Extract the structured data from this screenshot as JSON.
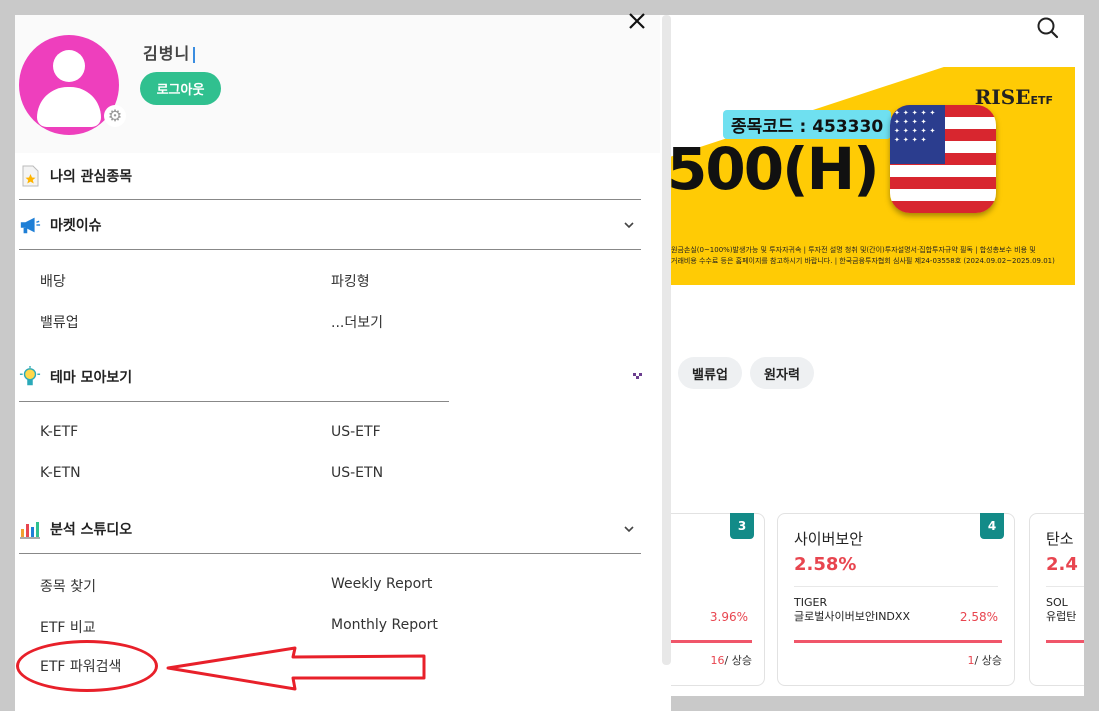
{
  "page": {
    "banner": {
      "logo": "RISE",
      "logo_suffix": "ETF",
      "code_label": "종목코드 : 453330",
      "big_text": "500(H)",
      "fine_print_1": "원금손실(0~100%)발생가능 및 투자자귀속 | 투자전 설명 청취 및(간이)투자설명서·집합투자규약 필독 | 합성총보수 비용 및",
      "fine_print_2": "거래비용 수수료 등은 홈페이지를 참고하시기 바랍니다. | 한국금융투자협회 심사필 제24-03558호 (2024.09.02~2025.09.01)"
    },
    "chips": [
      "밸류업",
      "원자력"
    ],
    "cards": [
      {
        "rank": "3",
        "name": "",
        "pct": "",
        "fund": "",
        "fund_pct": "3.96%",
        "count": "16",
        "count_suffix": "/ 상승"
      },
      {
        "rank": "4",
        "name": "사이버보안",
        "pct": "2.58%",
        "fund": "TIGER\n글로벌사이버보안INDXX",
        "fund_pct": "2.58%",
        "count": "1",
        "count_suffix": "/ 상승"
      },
      {
        "rank": "",
        "name": "탄소",
        "pct": "2.4",
        "fund": "SOL\n유럽탄",
        "fund_pct": "",
        "count": "",
        "count_suffix": ""
      }
    ]
  },
  "menu": {
    "profile": {
      "username": "김병니",
      "logout_label": "로그아웃"
    },
    "sections": {
      "watchlist": {
        "label": "나의 관심종목"
      },
      "market_issue": {
        "label": "마켓이슈",
        "items": [
          "배당",
          "파킹형",
          "밸류업",
          "...더보기"
        ]
      },
      "theme": {
        "label": "테마 모아보기",
        "items": [
          "K-ETF",
          "US-ETF",
          "K-ETN",
          "US-ETN"
        ]
      },
      "analysis": {
        "label": "분석 스튜디오",
        "items": [
          "종목 찾기",
          "Weekly Report",
          "ETF 비교",
          "Monthly Report",
          "ETF 파워검색"
        ]
      }
    }
  },
  "colors": {
    "accent_green": "#30c08f",
    "avatar_pink": "#ee3fbd",
    "annotation_red": "#e8202a",
    "rise_red": "#e8454f",
    "teal_rank": "#138b88"
  }
}
